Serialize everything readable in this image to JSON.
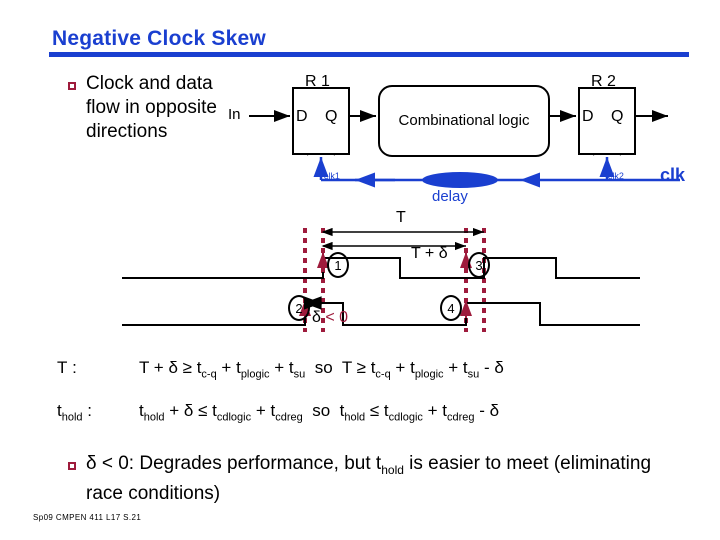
{
  "slide": {
    "title": "Negative Clock Skew",
    "footer": "Sp09  CMPEN 411  L17  S.21",
    "accent_blue": "#1a3fd0",
    "bullet_crimson": "#9e1b3c"
  },
  "bullets": [
    {
      "text": "Clock and data flow in opposite directions"
    },
    {
      "text": "δ < 0: Degrades performance, but thold is easier to meet (eliminating race conditions)"
    }
  ],
  "schematic": {
    "input_label": "In",
    "reg1": {
      "name": "R 1",
      "d": "D",
      "q": "Q",
      "clk_label": "t",
      "clk_sub": "clk1"
    },
    "reg2": {
      "name": "R 2",
      "d": "D",
      "q": "Q",
      "clk_label": "t",
      "clk_sub": "clk2"
    },
    "logic_block": "Combinational logic",
    "delay_label": "delay",
    "clock_label": "clk"
  },
  "timing": {
    "period_label": "T",
    "skewed_label": "T + δ",
    "skew_label": "δ",
    "skew_relation": "< 0",
    "markers": [
      "1",
      "2",
      "3",
      "4"
    ]
  },
  "equations": [
    {
      "label": "T :",
      "body": "T + δ ≥ tc-q + tplogic + tsu  so   T ≥ tc-q + tplogic + tsu - δ"
    },
    {
      "label": "thold :",
      "body": "thold + δ ≤ tcdlogic + tcdreg  so   thold ≤ tcdlogic + tcdreg - δ"
    }
  ]
}
